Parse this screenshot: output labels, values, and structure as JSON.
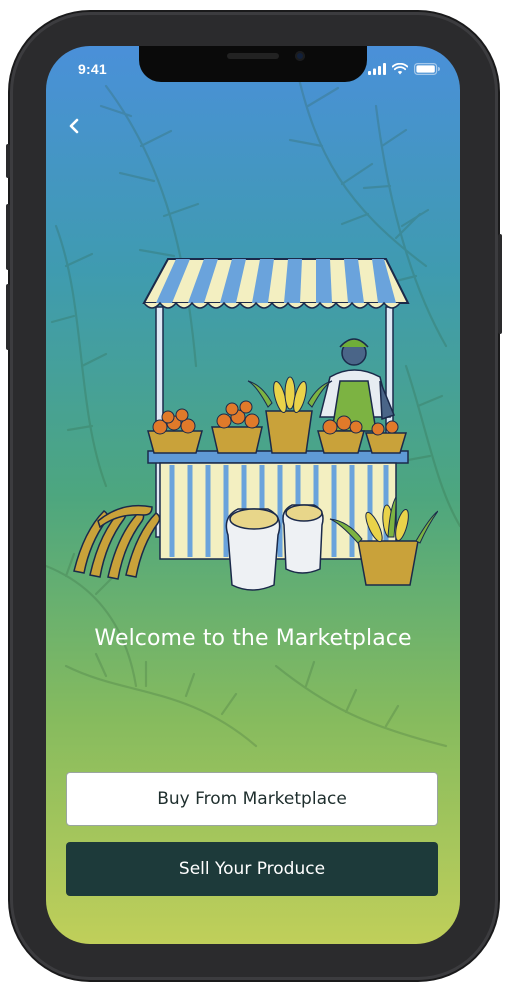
{
  "status_bar": {
    "time": "9:41",
    "icons": [
      "cellular-signal-icon",
      "wifi-icon",
      "battery-icon"
    ]
  },
  "navigation": {
    "back_icon": "chevron-left-icon"
  },
  "illustration": {
    "subject": "market-stall-illustration"
  },
  "welcome": {
    "title": "Welcome to the Marketplace"
  },
  "actions": {
    "buy_label": "Buy From Marketplace",
    "sell_label": "Sell Your Produce"
  },
  "colors": {
    "gradient_top": "#4a90d9",
    "gradient_bottom": "#c0cf5a",
    "primary_button": "#1d3a3a",
    "secondary_button": "#ffffff",
    "text_light": "#ffffff",
    "text_dark": "#1f2f2e"
  }
}
